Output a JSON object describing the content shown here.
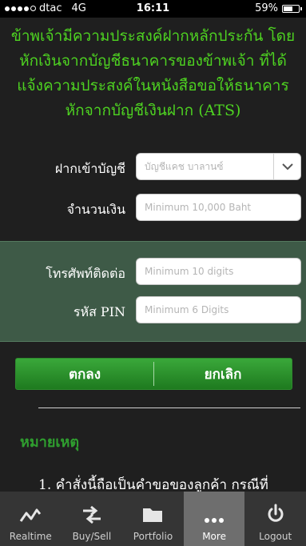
{
  "status_bar": {
    "carrier": "dtac",
    "network": "4G",
    "time": "16:11",
    "battery": "59%",
    "battery_level": 0.59
  },
  "notice_lines": [
    "ข้าพเจ้ามีความประสงค์ฝากหลักประกัน โดย",
    "หักเงินจากบัญชีธนาคารของข้าพเจ้า ที่ได้",
    "แจ้งความประสงค์ในหนังสือขอให้ธนาคาร",
    "หักจากบัญชีเงินฝาก (ATS)"
  ],
  "form": {
    "deposit_account": {
      "label": "ฝากเข้าบัญชี",
      "value": "บัญชีแคช บาลานซ์"
    },
    "amount": {
      "label": "จำนวนเงิน",
      "placeholder": "Minimum 10,000 Baht"
    },
    "phone": {
      "label": "โทรศัพท์ติดต่อ",
      "placeholder": "Minimum 10 digits"
    },
    "pin": {
      "label": "รหัส PIN",
      "placeholder": "Minimum 6 Digits"
    }
  },
  "buttons": {
    "ok": "ตกลง",
    "cancel": "ยกเลิก"
  },
  "remark": {
    "title": "หมายเหตุ",
    "first_line": "1.  คำสั่งนี้ถือเป็นคำขอของลูกค้า กรณีที่"
  },
  "tabs": [
    {
      "label": "Realtime",
      "icon": "chart-line-icon",
      "active": false
    },
    {
      "label": "Buy/Sell",
      "icon": "buy-sell-arrows-icon",
      "active": false
    },
    {
      "label": "Portfolio",
      "icon": "folder-icon",
      "active": false
    },
    {
      "label": "More",
      "icon": "more-dots-icon",
      "active": true
    },
    {
      "label": "Logout",
      "icon": "power-icon",
      "active": false
    }
  ],
  "colors": {
    "accent_green": "#4ed321",
    "panel_green": "#3e5a47",
    "button_green": "#2a8f2b",
    "background": "#1f1f1f"
  }
}
